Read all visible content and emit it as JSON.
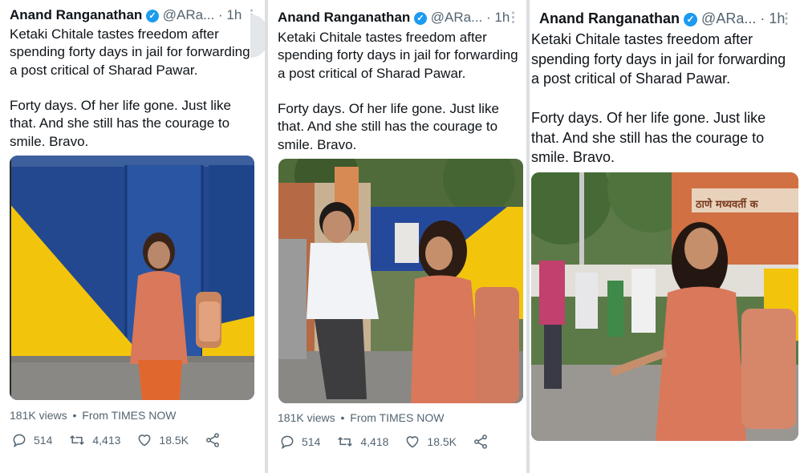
{
  "tweets": [
    {
      "author_name": "Anand Ranganathan",
      "handle": "@ARa...",
      "separator": "·",
      "time": "1h",
      "more_label": "⋮",
      "text": "Ketaki Chitale tastes freedom after\nspending forty days in jail for forwarding\na post critical of Sharad Pawar.\n\nForty days. Of her life gone. Just like\nthat. And she still has the courage to\nsmile. Bravo.",
      "views": "181K views",
      "from": "From TIMES NOW",
      "replies": "514",
      "retweets": "4,413",
      "likes": "18.5K"
    },
    {
      "author_name": "Anand Ranganathan",
      "handle": "@ARa...",
      "separator": "·",
      "time": "1h",
      "more_label": "⋮",
      "text": "Ketaki Chitale tastes freedom after\nspending forty days in jail for forwarding\na post critical of Sharad Pawar.\n\nForty days. Of her life gone. Just like\nthat. And she still has the courage to\nsmile. Bravo.",
      "views": "181K views",
      "from": "From TIMES NOW",
      "replies": "514",
      "retweets": "4,418",
      "likes": "18.5K"
    },
    {
      "author_name": "Anand Ranganathan",
      "handle": "@ARa...",
      "separator": "·",
      "time": "1h",
      "more_label": "⋮",
      "text": "Ketaki Chitale tastes freedom after\nspending forty days in jail for forwarding\na post critical of Sharad Pawar.\n\nForty days. Of her life gone. Just like\nthat. And she still has the courage to\nsmile. Bravo.",
      "sign_text": "ठाणे मध्यवर्ती क"
    }
  ],
  "interpunct": "•",
  "verified_mark": "✓",
  "colors": {
    "verified_blue": "#1d9bf0",
    "secondary_text": "#536471",
    "gate_blue": "#1f4d9c",
    "wall_yellow": "#f2c40c",
    "kurta_orange": "#d9785a"
  },
  "icons": [
    "reply-icon",
    "retweet-icon",
    "like-icon",
    "share-icon",
    "verified-badge-icon",
    "more-icon"
  ]
}
